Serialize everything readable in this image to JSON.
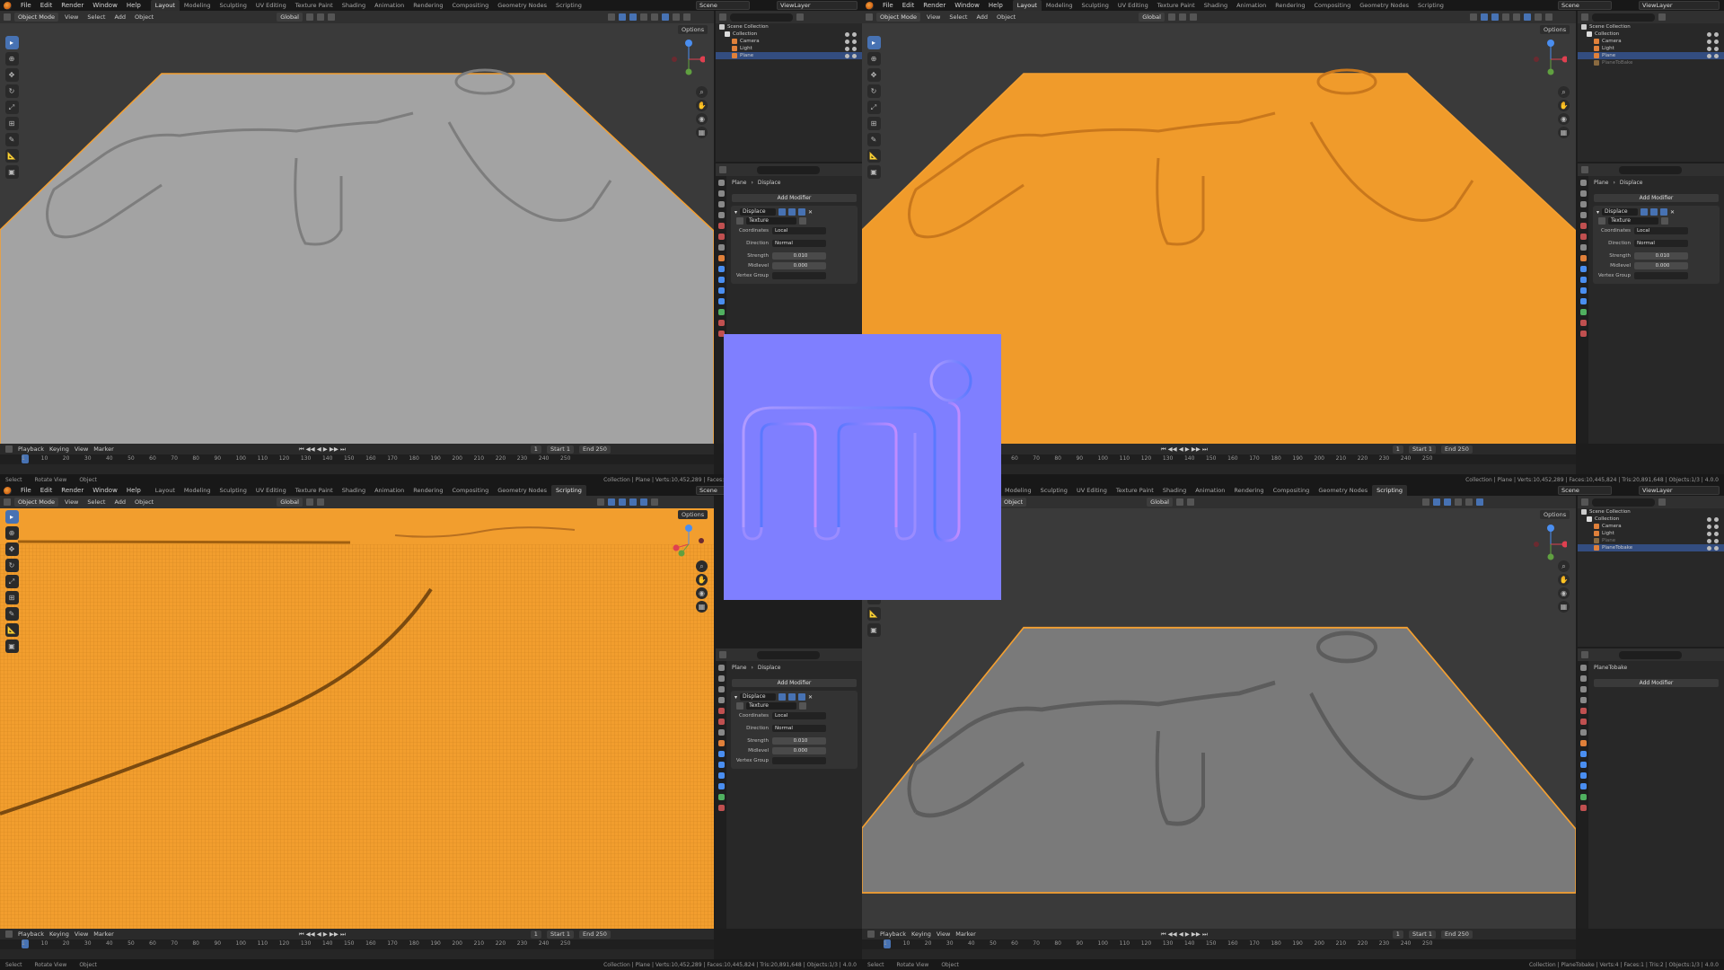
{
  "app": {
    "menu": [
      "File",
      "Edit",
      "Render",
      "Window",
      "Help"
    ],
    "workspaces": [
      "Layout",
      "Modeling",
      "Sculpting",
      "UV Editing",
      "Texture Paint",
      "Shading",
      "Animation",
      "Rendering",
      "Compositing",
      "Geometry Nodes",
      "Scripting"
    ],
    "scene": "Scene",
    "view_layer": "ViewLayer"
  },
  "viewport_header": {
    "mode": "Object Mode",
    "menus": [
      "View",
      "Select",
      "Add",
      "Object"
    ],
    "orientation": "Global",
    "options": "Options"
  },
  "outliner": {
    "scene_collection": "Scene Collection",
    "collection": "Collection",
    "items_a": [
      "Camera",
      "Light",
      "Plane"
    ],
    "items_b": [
      "Camera",
      "Light",
      "Plane",
      "PlaneToBake"
    ],
    "item_bake": "PlaneTobake"
  },
  "properties": {
    "object": "Plane",
    "modifier": "Displace",
    "add_modifier": "Add Modifier",
    "texture_label": "Texture",
    "coordinates_label": "Coordinates",
    "coordinates": "Local",
    "direction_label": "Direction",
    "direction": "Normal",
    "strength_label": "Strength",
    "strength": "0.010",
    "midlevel_label": "Midlevel",
    "midlevel": "0.000",
    "vertex_group_label": "Vertex Group",
    "bake_object": "PlaneTobake"
  },
  "timeline": {
    "menus": [
      "Playback",
      "Keying",
      "View",
      "Marker"
    ],
    "current_frame": "1",
    "start_label": "Start",
    "start": "1",
    "end_label": "End",
    "end": "250",
    "ticks": [
      "1",
      "10",
      "20",
      "30",
      "40",
      "50",
      "60",
      "70",
      "80",
      "90",
      "100",
      "110",
      "120",
      "130",
      "140",
      "150",
      "160",
      "170",
      "180",
      "190",
      "200",
      "210",
      "220",
      "230",
      "240",
      "250"
    ]
  },
  "status": {
    "select": "Select",
    "rotate": "Rotate View",
    "object": "Object",
    "stats_plane": "Collection | Plane | Verts:10,452,289 | Faces:10,445,824 | Tris:20,891,648 | Objects:1/3 | 4.0.0",
    "stats_bake": "Collection | PlaneTobake | Verts:4 | Faces:1 | Tris:2 | Objects:1/3 | 4.0.0"
  },
  "colors": {
    "accent": "#4772b3",
    "selection": "#f5a030",
    "object_orange": "#f09b2b",
    "normal_map_base": "#7f7fff"
  }
}
